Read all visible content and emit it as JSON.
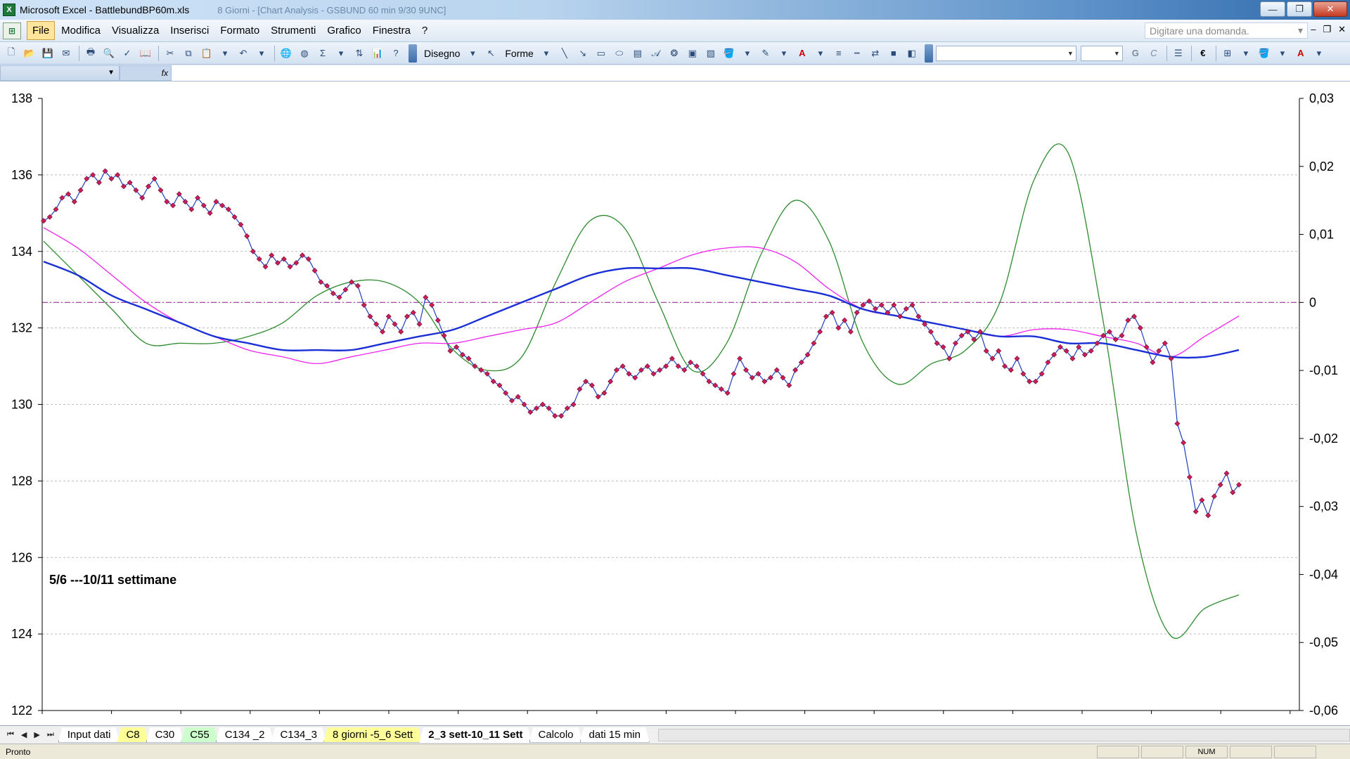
{
  "window": {
    "app_title": "Microsoft Excel - BattlebundBP60m.xls",
    "title_ghost": "8 Giorni - [Chart Analysis - GSBUND 60 min 9/30 9UNC]",
    "minimize": "—",
    "maximize": "❐",
    "close": "✕"
  },
  "menu": {
    "items": [
      "File",
      "Modifica",
      "Visualizza",
      "Inserisci",
      "Formato",
      "Strumenti",
      "Grafico",
      "Finestra",
      "?"
    ],
    "help_placeholder": "Digitare una domanda.",
    "mdi_minimize": "–",
    "mdi_restore": "❐",
    "mdi_close": "✕"
  },
  "toolbar": {
    "disegno_label": "Disegno",
    "forme_label": "Forme",
    "bold_label": "G",
    "italic_label": "C",
    "euro_label": "€",
    "font_color_label": "A"
  },
  "formula_bar": {
    "fx_label": "fx",
    "name_box": ""
  },
  "chart_data": {
    "type": "line",
    "title": "",
    "annotation": "5/6 ---10/11 settimane",
    "annotation_color": "#228b22",
    "left_axis": {
      "min": 122,
      "max": 138,
      "ticks": [
        "138",
        "136",
        "134",
        "132",
        "130",
        "128",
        "126",
        "124",
        "122"
      ]
    },
    "right_axis": {
      "min": -0.06,
      "max": 0.03,
      "ticks": [
        "0,03",
        "0,02",
        "0,01",
        "0",
        "-0,01",
        "-0,02",
        "-0,03",
        "-0,04",
        "-0,05",
        "-0,06"
      ]
    },
    "gridlines": "horizontal dashed",
    "reference_line": {
      "axis": "right",
      "value": 0,
      "color": "#993399",
      "style": "dash-dot"
    },
    "series": [
      {
        "axis": "left",
        "color": "#1f3fbf",
        "marker_color": "#cc1d5a",
        "markers": true,
        "values": [
          134.8,
          134.9,
          135.1,
          135.4,
          135.5,
          135.3,
          135.6,
          135.9,
          136.0,
          135.8,
          136.1,
          135.9,
          136.0,
          135.7,
          135.8,
          135.6,
          135.4,
          135.7,
          135.9,
          135.6,
          135.3,
          135.2,
          135.5,
          135.3,
          135.1,
          135.4,
          135.2,
          135.0,
          135.3,
          135.2,
          135.1,
          134.9,
          134.7,
          134.4,
          134.0,
          133.8,
          133.6,
          133.9,
          133.7,
          133.8,
          133.6,
          133.7,
          133.9,
          133.8,
          133.5,
          133.2,
          133.1,
          132.9,
          132.8,
          133.0,
          133.2,
          133.1,
          132.6,
          132.3,
          132.1,
          131.9,
          132.3,
          132.1,
          131.9,
          132.3,
          132.4,
          132.1,
          132.8,
          132.6,
          132.2,
          131.8,
          131.4,
          131.5,
          131.3,
          131.2,
          131.0,
          130.9,
          130.8,
          130.6,
          130.5,
          130.3,
          130.1,
          130.2,
          130.0,
          129.8,
          129.9,
          130.0,
          129.9,
          129.7,
          129.7,
          129.9,
          130.0,
          130.4,
          130.6,
          130.5,
          130.2,
          130.3,
          130.6,
          130.9,
          131.0,
          130.8,
          130.7,
          130.9,
          131.0,
          130.8,
          130.9,
          131.0,
          131.2,
          131.0,
          130.9,
          131.1,
          131.0,
          130.8,
          130.6,
          130.5,
          130.4,
          130.3,
          130.8,
          131.2,
          130.9,
          130.7,
          130.8,
          130.6,
          130.7,
          130.9,
          130.7,
          130.5,
          130.9,
          131.1,
          131.3,
          131.6,
          131.9,
          132.3,
          132.4,
          132.0,
          132.2,
          131.9,
          132.4,
          132.6,
          132.7,
          132.5,
          132.6,
          132.4,
          132.6,
          132.3,
          132.5,
          132.6,
          132.3,
          132.1,
          131.9,
          131.6,
          131.5,
          131.2,
          131.6,
          131.8,
          131.9,
          131.7,
          131.9,
          131.4,
          131.2,
          131.4,
          131.0,
          130.9,
          131.2,
          130.8,
          130.6,
          130.6,
          130.8,
          131.1,
          131.3,
          131.5,
          131.4,
          131.2,
          131.5,
          131.3,
          131.4,
          131.6,
          131.8,
          131.9,
          131.7,
          131.8,
          132.2,
          132.3,
          132.0,
          131.5,
          131.1,
          131.4,
          131.6,
          131.2,
          129.5,
          129.0,
          128.1,
          127.2,
          127.5,
          127.1,
          127.6,
          127.9,
          128.2,
          127.7,
          127.9
        ]
      },
      {
        "axis": "right",
        "color": "#2e8b2e",
        "markers": false,
        "values": [
          0.009,
          0.004,
          -0.001,
          -0.006,
          -0.006,
          -0.006,
          -0.005,
          -0.003,
          0.001,
          0.003,
          0.003,
          0.0,
          -0.007,
          -0.01,
          -0.008,
          0.003,
          0.012,
          0.011,
          0.0,
          -0.01,
          -0.006,
          0.007,
          0.015,
          0.009,
          -0.006,
          -0.012,
          -0.009,
          -0.007,
          0.0,
          0.018,
          0.022,
          -0.002,
          -0.034,
          -0.049,
          -0.045,
          -0.043
        ]
      },
      {
        "axis": "right",
        "color": "#ee22ee",
        "markers": false,
        "values": [
          0.011,
          0.008,
          0.004,
          0.0,
          -0.003,
          -0.005,
          -0.007,
          -0.008,
          -0.009,
          -0.008,
          -0.007,
          -0.006,
          -0.006,
          -0.005,
          -0.004,
          -0.003,
          0.0,
          0.003,
          0.005,
          0.007,
          0.008,
          0.008,
          0.006,
          0.002,
          -0.001,
          -0.002,
          -0.003,
          -0.004,
          -0.005,
          -0.004,
          -0.004,
          -0.005,
          -0.006,
          -0.008,
          -0.005,
          -0.002
        ]
      },
      {
        "axis": "right",
        "color": "#1a2fd6",
        "markers": false,
        "values": [
          0.006,
          0.004,
          0.001,
          -0.001,
          -0.003,
          -0.005,
          -0.006,
          -0.007,
          -0.007,
          -0.007,
          -0.006,
          -0.005,
          -0.004,
          -0.002,
          0.0,
          0.002,
          0.004,
          0.005,
          0.005,
          0.005,
          0.004,
          0.003,
          0.002,
          0.001,
          -0.001,
          -0.002,
          -0.003,
          -0.004,
          -0.005,
          -0.005,
          -0.006,
          -0.006,
          -0.007,
          -0.008,
          -0.008,
          -0.007
        ]
      }
    ]
  },
  "sheet_tabs": {
    "nav": [
      "⏮",
      "◀",
      "▶",
      "⏭"
    ],
    "tabs": [
      {
        "label": "Input dati",
        "color": "white"
      },
      {
        "label": "C8",
        "color": "yellow"
      },
      {
        "label": "C30",
        "color": "white"
      },
      {
        "label": "C55",
        "color": "green"
      },
      {
        "label": "C134 _2",
        "color": "white"
      },
      {
        "label": "C134_3",
        "color": "white"
      },
      {
        "label": "8 giorni -5_6 Sett",
        "color": "yellow"
      },
      {
        "label": "2_3 sett-10_11 Sett",
        "color": "selected"
      },
      {
        "label": "Calcolo",
        "color": "white"
      },
      {
        "label": "dati 15 min",
        "color": "white"
      }
    ]
  },
  "status": {
    "text": "Pronto",
    "num": "NUM"
  }
}
